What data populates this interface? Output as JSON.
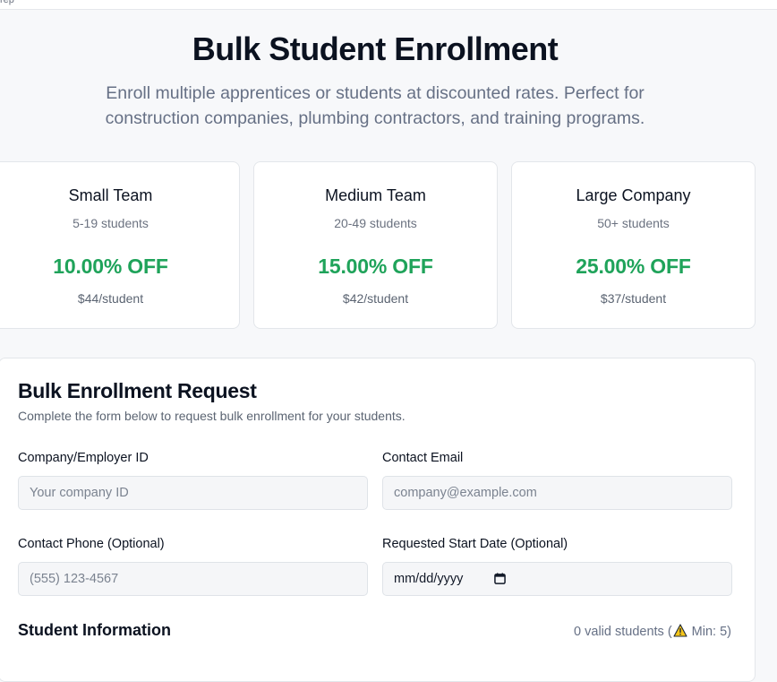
{
  "topbar": {
    "text": "rep"
  },
  "header": {
    "title": "Bulk Student Enrollment",
    "subtitle": "Enroll multiple apprentices or students at discounted rates. Perfect for construction companies, plumbing contractors, and training programs."
  },
  "tiers": [
    {
      "name": "Small Team",
      "range": "5-19 students",
      "discount": "10.00% OFF",
      "price": "$44/student"
    },
    {
      "name": "Medium Team",
      "range": "20-49 students",
      "discount": "15.00% OFF",
      "price": "$42/student"
    },
    {
      "name": "Large Company",
      "range": "50+ students",
      "discount": "25.00% OFF",
      "price": "$37/student"
    }
  ],
  "form": {
    "title": "Bulk Enrollment Request",
    "description": "Complete the form below to request bulk enrollment for your students.",
    "company_id": {
      "label": "Company/Employer ID",
      "placeholder": "Your company ID",
      "value": ""
    },
    "contact_email": {
      "label": "Contact Email",
      "placeholder": "company@example.com",
      "value": ""
    },
    "contact_phone": {
      "label": "Contact Phone (Optional)",
      "placeholder": "(555) 123-4567",
      "value": ""
    },
    "start_date": {
      "label": "Requested Start Date (Optional)",
      "placeholder": "mm/dd/yyyy",
      "icon": "calendar-icon"
    }
  },
  "students": {
    "title": "Student Information",
    "valid_prefix": "0 valid students (",
    "min_label": " Min: 5)",
    "warning_icon": "warning-icon"
  },
  "colors": {
    "discount": "#1fa35a",
    "warning": "#f5c518"
  }
}
